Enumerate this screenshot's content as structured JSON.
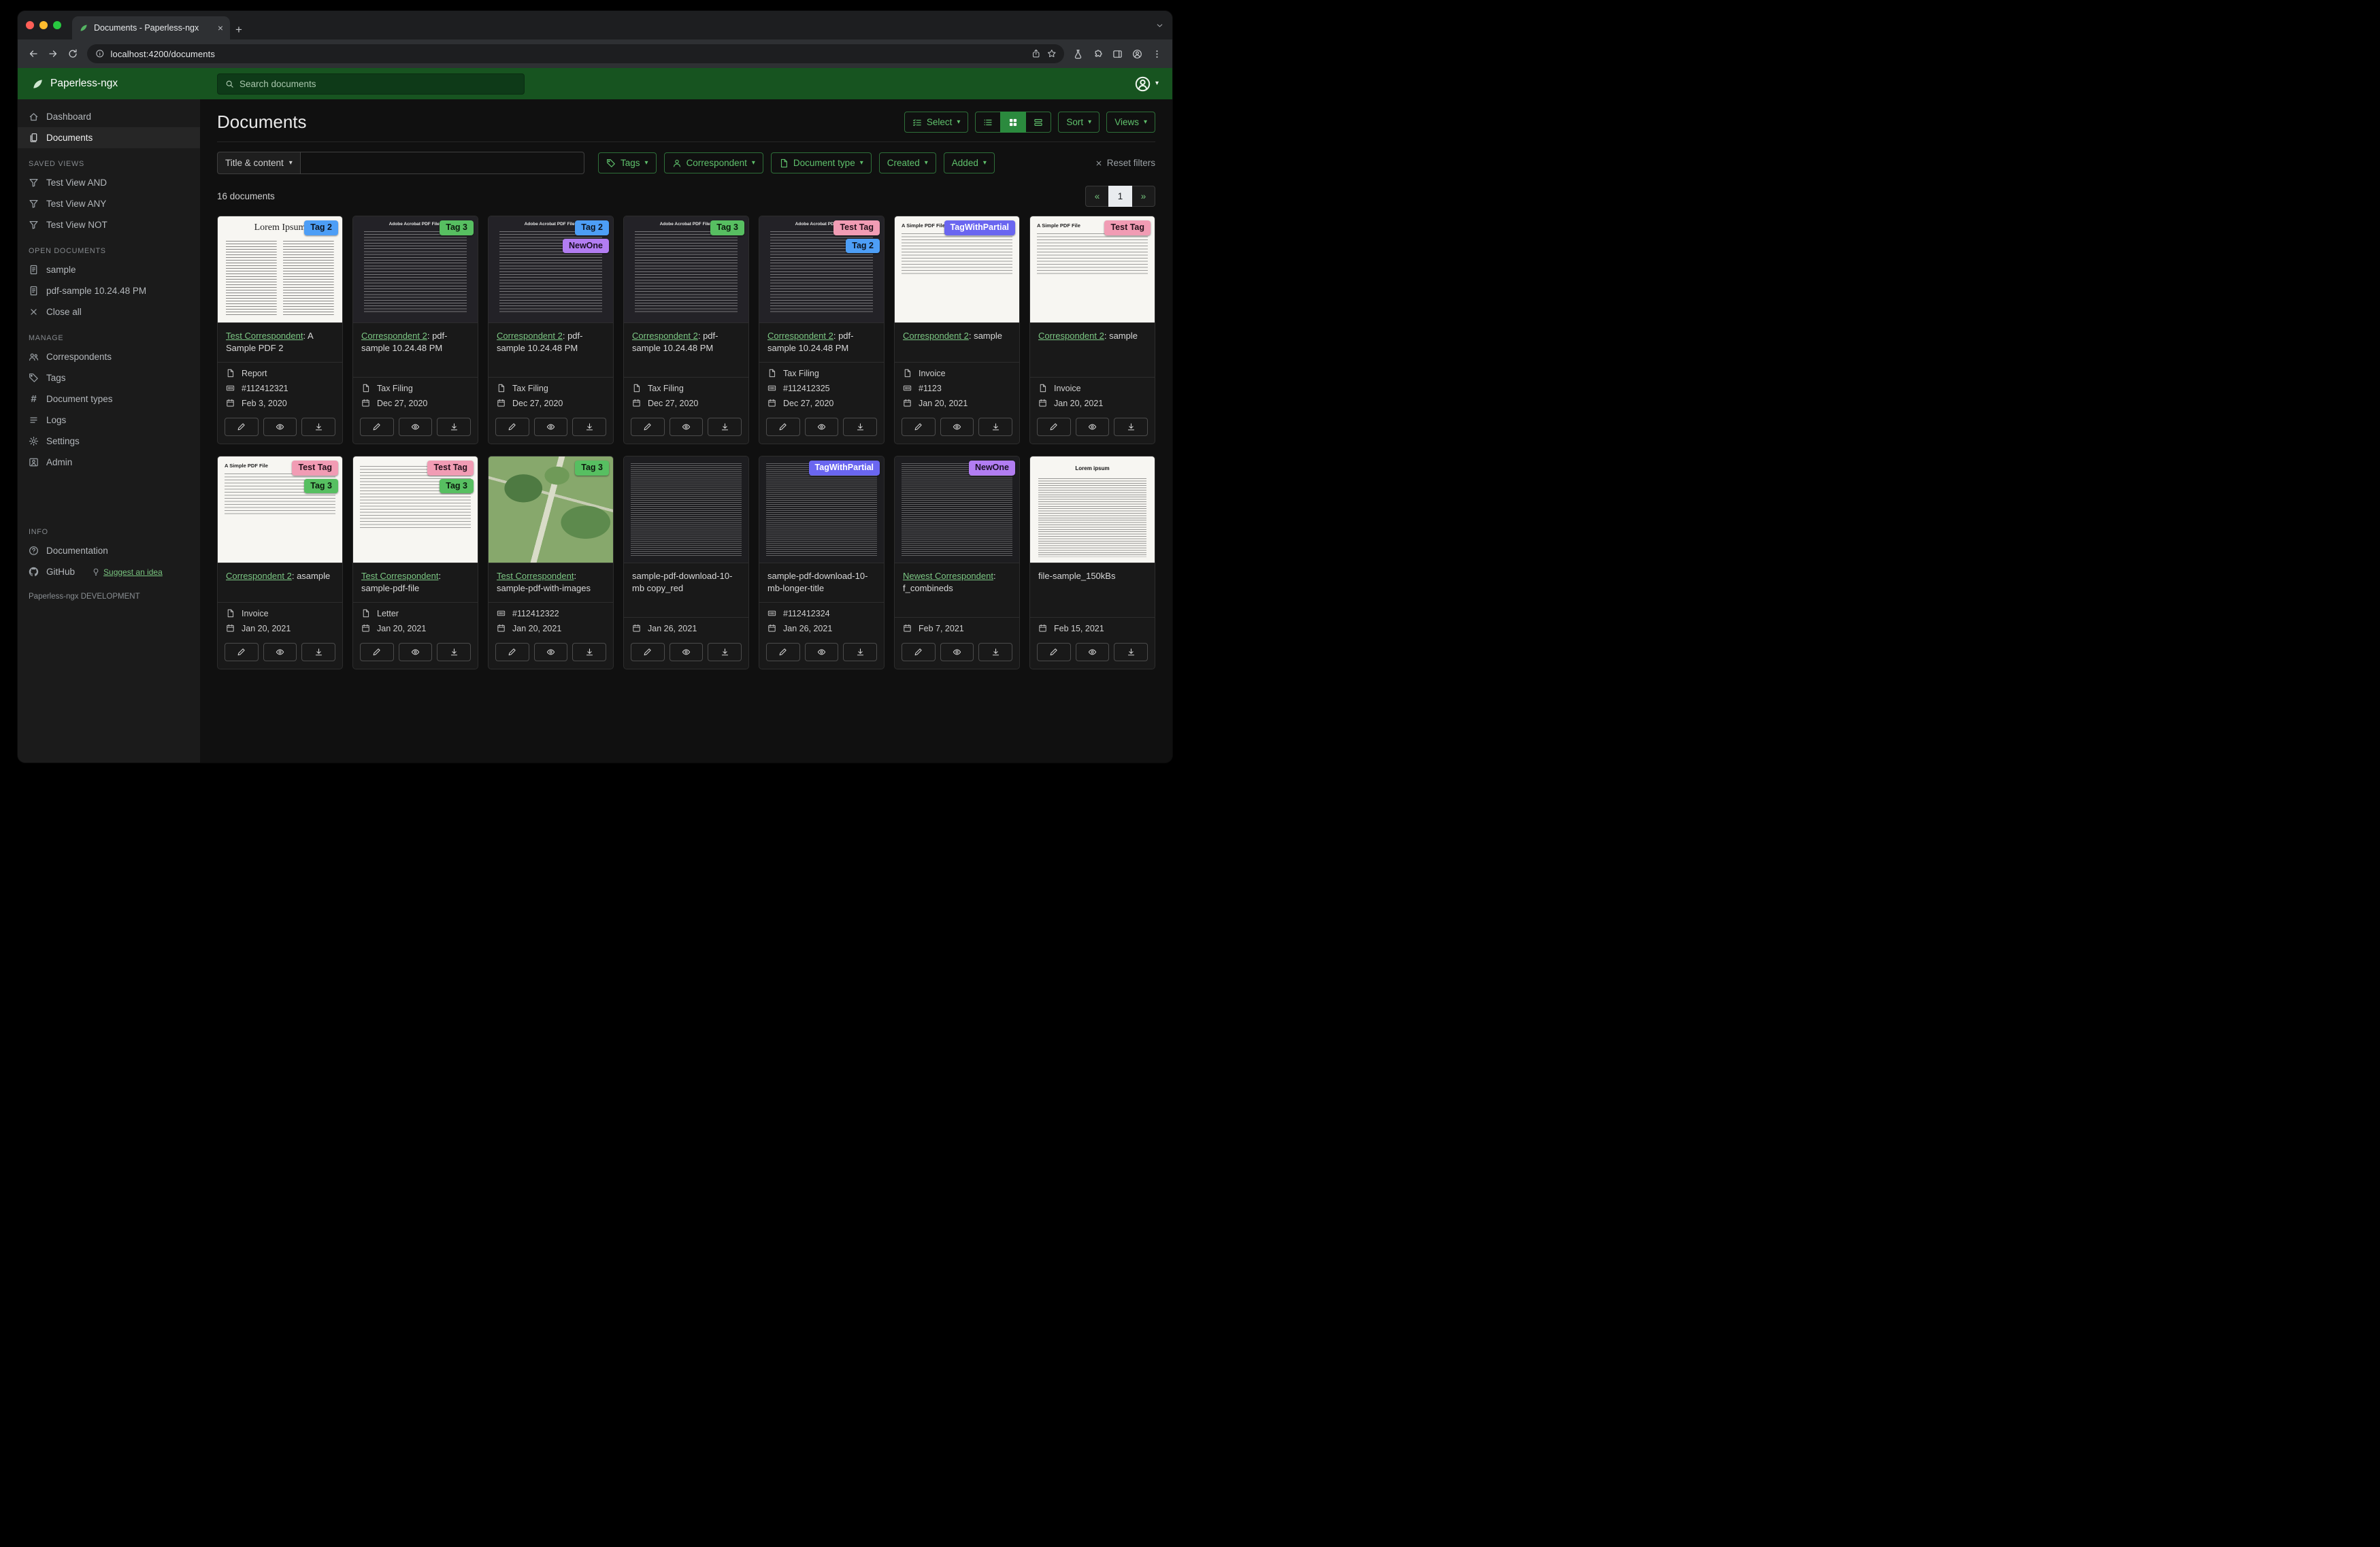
{
  "browser": {
    "tab_title": "Documents - Paperless-ngx",
    "url": "localhost:4200/documents"
  },
  "header": {
    "brand": "Paperless-ngx",
    "search_placeholder": "Search documents"
  },
  "sidebar": {
    "main": [
      {
        "label": "Dashboard",
        "icon": "home"
      },
      {
        "label": "Documents",
        "icon": "files",
        "active": true
      }
    ],
    "saved_views_title": "SAVED VIEWS",
    "saved_views": [
      {
        "label": "Test View AND",
        "icon": "funnel"
      },
      {
        "label": "Test View ANY",
        "icon": "funnel"
      },
      {
        "label": "Test View NOT",
        "icon": "funnel"
      }
    ],
    "open_documents_title": "OPEN DOCUMENTS",
    "open_documents": [
      {
        "label": "sample",
        "icon": "file-text"
      },
      {
        "label": "pdf-sample 10.24.48 PM",
        "icon": "file-text"
      }
    ],
    "close_all": "Close all",
    "manage_title": "MANAGE",
    "manage": [
      {
        "label": "Correspondents",
        "icon": "people"
      },
      {
        "label": "Tags",
        "icon": "tag"
      },
      {
        "label": "Document types",
        "icon": "hash"
      },
      {
        "label": "Logs",
        "icon": "list"
      },
      {
        "label": "Settings",
        "icon": "gear"
      },
      {
        "label": "Admin",
        "icon": "admin"
      }
    ],
    "info_title": "INFO",
    "documentation_label": "Documentation",
    "github_label": "GitHub",
    "suggest_label": "Suggest an idea",
    "footer": "Paperless-ngx DEVELOPMENT"
  },
  "toolbar": {
    "page_title": "Documents",
    "select_label": "Select",
    "sort_label": "Sort",
    "views_label": "Views"
  },
  "filters": {
    "field_label": "Title & content",
    "text_value": "",
    "chips": [
      {
        "label": "Tags",
        "icon": "tag"
      },
      {
        "label": "Correspondent",
        "icon": "person"
      },
      {
        "label": "Document type",
        "icon": "file"
      },
      {
        "label": "Created"
      },
      {
        "label": "Added"
      }
    ],
    "reset_label": "Reset filters"
  },
  "results": {
    "count": "16 documents",
    "pagination": {
      "prev": "«",
      "current": "1",
      "next": "»"
    }
  },
  "documents": [
    {
      "thumb": {
        "kind": "lorem",
        "heading": "Lorem Ipsum"
      },
      "tags": [
        {
          "label": "Tag 2",
          "bg": "#4d9ef6",
          "fg": "#0c1420"
        }
      ],
      "title_link": "Test Correspondent",
      "title_rest": ": A Sample PDF 2",
      "doc_type": "Report",
      "asn": "#112412321",
      "date": "Feb 3, 2020"
    },
    {
      "thumb": {
        "kind": "pdf-dark",
        "heading": "Adobe Acrobat PDF Files"
      },
      "tags": [
        {
          "label": "Tag 3",
          "bg": "#57bf61",
          "fg": "#0c1a0e"
        }
      ],
      "title_link": "Correspondent 2",
      "title_rest": ": pdf-sample 10.24.48 PM",
      "doc_type": "Tax Filing",
      "date": "Dec 27, 2020"
    },
    {
      "thumb": {
        "kind": "pdf-dark",
        "heading": "Adobe Acrobat PDF Files"
      },
      "tags": [
        {
          "label": "Tag 2",
          "bg": "#4d9ef6",
          "fg": "#0c1420"
        },
        {
          "label": "NewOne",
          "bg": "#b27df2",
          "fg": "#190f24"
        }
      ],
      "title_link": "Correspondent 2",
      "title_rest": ": pdf-sample 10.24.48 PM",
      "doc_type": "Tax Filing",
      "date": "Dec 27, 2020"
    },
    {
      "thumb": {
        "kind": "pdf-dark",
        "heading": "Adobe Acrobat PDF Files"
      },
      "tags": [
        {
          "label": "Tag 3",
          "bg": "#57bf61",
          "fg": "#0c1a0e"
        }
      ],
      "title_link": "Correspondent 2",
      "title_rest": ": pdf-sample 10.24.48 PM",
      "doc_type": "Tax Filing",
      "date": "Dec 27, 2020"
    },
    {
      "thumb": {
        "kind": "pdf-dark",
        "heading": "Adobe Acrobat PDF Files"
      },
      "tags": [
        {
          "label": "Test Tag",
          "bg": "#f19cb4",
          "fg": "#24101a"
        },
        {
          "label": "Tag 2",
          "bg": "#4d9ef6",
          "fg": "#0c1420"
        }
      ],
      "title_link": "Correspondent 2",
      "title_rest": ": pdf-sample 10.24.48 PM",
      "doc_type": "Tax Filing",
      "asn": "#112412325",
      "date": "Dec 27, 2020"
    },
    {
      "thumb": {
        "kind": "simple",
        "heading": "A Simple PDF File"
      },
      "tags": [
        {
          "label": "TagWithPartial",
          "bg": "#6a66f0",
          "fg": "#ffffff"
        }
      ],
      "title_link": "Correspondent 2",
      "title_rest": ": sample",
      "doc_type": "Invoice",
      "asn": "#1123",
      "date": "Jan 20, 2021"
    },
    {
      "thumb": {
        "kind": "simple",
        "heading": "A Simple PDF File"
      },
      "tags": [
        {
          "label": "Test Tag",
          "bg": "#f19cb4",
          "fg": "#24101a"
        }
      ],
      "title_link": "Correspondent 2",
      "title_rest": ": sample",
      "doc_type": "Invoice",
      "date": "Jan 20, 2021"
    },
    {
      "thumb": {
        "kind": "simple",
        "heading": "A Simple PDF File"
      },
      "tags": [
        {
          "label": "Test Tag",
          "bg": "#f19cb4",
          "fg": "#24101a"
        },
        {
          "label": "Tag 3",
          "bg": "#57bf61",
          "fg": "#0c1a0e"
        }
      ],
      "title_link": "Correspondent 2",
      "title_rest": ": asample",
      "doc_type": "Invoice",
      "date": "Jan 20, 2021"
    },
    {
      "thumb": {
        "kind": "letter",
        "heading": ""
      },
      "tags": [
        {
          "label": "Test Tag",
          "bg": "#f19cb4",
          "fg": "#24101a"
        },
        {
          "label": "Tag 3",
          "bg": "#57bf61",
          "fg": "#0c1a0e"
        }
      ],
      "title_link": "Test Correspondent",
      "title_rest": ": sample-pdf-file",
      "doc_type": "Letter",
      "date": "Jan 20, 2021"
    },
    {
      "thumb": {
        "kind": "map",
        "heading": ""
      },
      "tags": [
        {
          "label": "Tag 3",
          "bg": "#57bf61",
          "fg": "#0c1a0e"
        }
      ],
      "title_link": "Test Correspondent",
      "title_rest": ": sample-pdf-with-images",
      "asn": "#112412322",
      "date": "Jan 20, 2021"
    },
    {
      "thumb": {
        "kind": "dense-dark",
        "heading": ""
      },
      "tags": [],
      "title_link": "",
      "title_rest": "sample-pdf-download-10-mb copy_red",
      "date": "Jan 26, 2021"
    },
    {
      "thumb": {
        "kind": "dense-dark",
        "heading": ""
      },
      "tags": [
        {
          "label": "TagWithPartial",
          "bg": "#6a66f0",
          "fg": "#ffffff"
        }
      ],
      "title_link": "",
      "title_rest": "sample-pdf-download-10-mb-longer-title",
      "asn": "#112412324",
      "date": "Jan 26, 2021"
    },
    {
      "thumb": {
        "kind": "dense-dark",
        "heading": ""
      },
      "tags": [
        {
          "label": "NewOne",
          "bg": "#b27df2",
          "fg": "#190f24"
        }
      ],
      "title_link": "Newest Correspondent",
      "title_rest": ": f_combineds",
      "date": "Feb 7, 2021"
    },
    {
      "thumb": {
        "kind": "lorem2",
        "heading": "Lorem ipsum"
      },
      "tags": [],
      "title_link": "",
      "title_rest": "file-sample_150kBs",
      "date": "Feb 15, 2021"
    }
  ]
}
